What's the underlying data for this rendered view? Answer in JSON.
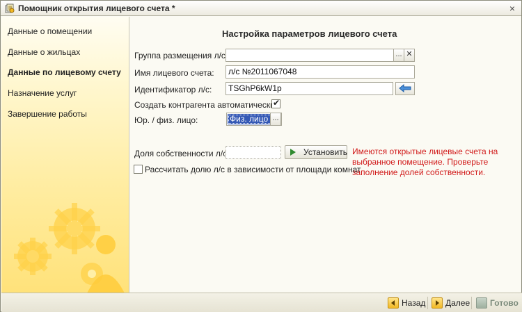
{
  "window": {
    "title": "Помощник открытия лицевого счета *",
    "close_glyph": "×"
  },
  "sidebar": {
    "items": [
      {
        "label": "Данные о помещении"
      },
      {
        "label": "Данные о жильцах"
      },
      {
        "label": "Данные по лицевому счету"
      },
      {
        "label": "Назначение услуг"
      },
      {
        "label": "Завершение работы"
      }
    ],
    "active_index": 2
  },
  "main": {
    "heading": "Настройка параметров лицевого счета",
    "group": {
      "label": "Группа размещения л/с:",
      "value": "",
      "select_glyph": "...",
      "clear_glyph": "✕"
    },
    "account_name": {
      "label": "Имя лицевого счета:",
      "value": "л/с №2011067048"
    },
    "identifier": {
      "label": "Идентификатор л/с:",
      "value": "TSGhP6kW1p"
    },
    "auto_contractor": {
      "label": "Создать контрагента автоматически",
      "checked": true,
      "check_glyph": "✔"
    },
    "entity_type": {
      "label": "Юр. / физ. лицо:",
      "value": "Физ. лицо",
      "select_glyph": "..."
    },
    "ownership": {
      "label": "Доля собственности л/с:",
      "value": "",
      "set_button": "Установить"
    },
    "by_area": {
      "label": "Рассчитать долю л/с в зависимости от площади комнат",
      "checked": false
    },
    "warning": "Имеются открытые лицевые счета на выбранное помещение. Проверьте заполнение долей собственности."
  },
  "footer": {
    "back": "Назад",
    "next": "Далее",
    "done": "Готово"
  },
  "colors": {
    "warning": "#d11a1a",
    "selection": "#3559b5",
    "sidebar_gold": "#ffe27a"
  }
}
